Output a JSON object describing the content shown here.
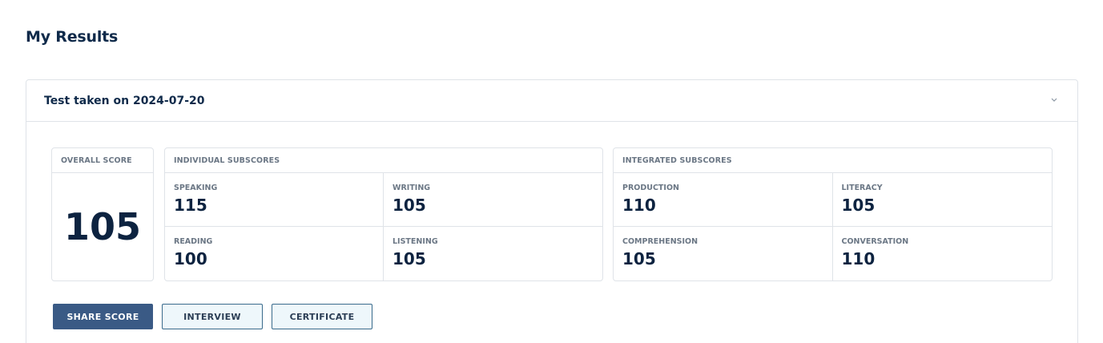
{
  "page": {
    "title": "My Results"
  },
  "test": {
    "header": "Test taken on 2024-07-20",
    "chevron_icon": "chevron-down-icon"
  },
  "overall": {
    "label": "Overall Score",
    "value": "105"
  },
  "individual": {
    "label": "Individual Subscores",
    "items": [
      {
        "label": "Speaking",
        "value": "115"
      },
      {
        "label": "Writing",
        "value": "105"
      },
      {
        "label": "Reading",
        "value": "100"
      },
      {
        "label": "Listening",
        "value": "105"
      }
    ]
  },
  "integrated": {
    "label": "Integrated Subscores",
    "items": [
      {
        "label": "Production",
        "value": "110"
      },
      {
        "label": "Literacy",
        "value": "105"
      },
      {
        "label": "Comprehension",
        "value": "105"
      },
      {
        "label": "Conversation",
        "value": "110"
      }
    ]
  },
  "actions": {
    "share": "SHARE SCORE",
    "interview": "INTERVIEW",
    "certificate": "CERTIFICATE"
  },
  "colors": {
    "primary": "#3a5a85",
    "text_dark": "#0d2340",
    "label_gray": "#6b7785",
    "border": "#dfe3e8",
    "secondary_bg": "#eef7fb"
  }
}
